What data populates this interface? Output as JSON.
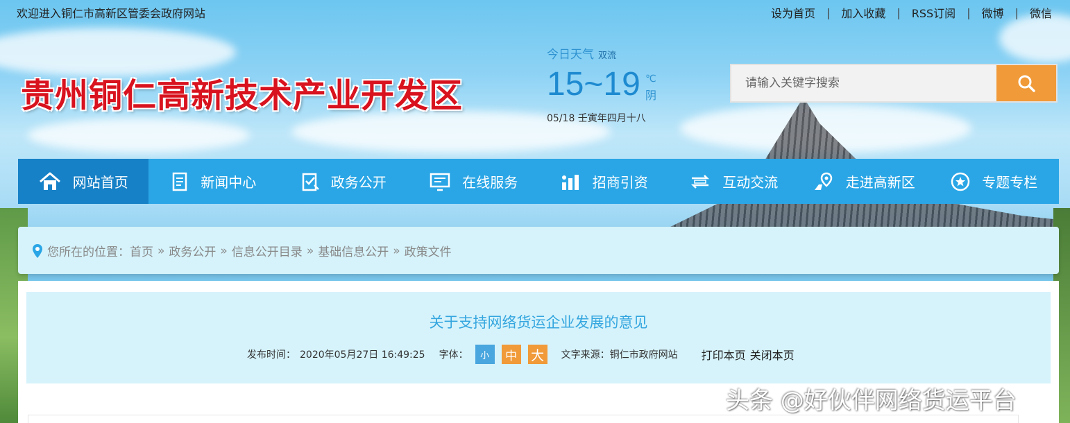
{
  "topbar": {
    "welcome": "欢迎进入铜仁市高新区管委会政府网站",
    "links": [
      "设为首页",
      "加入收藏",
      "RSS订阅",
      "微博",
      "微信"
    ],
    "separator": "|"
  },
  "header": {
    "site_title": "贵州铜仁高新技术产业开发区"
  },
  "weather": {
    "label": "今日天气",
    "city": "双流",
    "temp_range": "15~19",
    "unit": "℃",
    "condition": "阴",
    "date": "05/18 壬寅年四月十八"
  },
  "search": {
    "placeholder": "请输入关键字搜索",
    "button_icon": "search-icon"
  },
  "nav": {
    "items": [
      {
        "label": "网站首页",
        "icon": "home-icon"
      },
      {
        "label": "新闻中心",
        "icon": "document-icon"
      },
      {
        "label": "政务公开",
        "icon": "checklist-icon"
      },
      {
        "label": "在线服务",
        "icon": "monitor-icon"
      },
      {
        "label": "招商引资",
        "icon": "investment-icon"
      },
      {
        "label": "互动交流",
        "icon": "exchange-icon"
      },
      {
        "label": "走进高新区",
        "icon": "map-pin-icon"
      },
      {
        "label": "专题专栏",
        "icon": "star-icon"
      }
    ]
  },
  "breadcrumb": {
    "prefix": "您所在的位置：",
    "items": [
      "首页",
      "政务公开",
      "信息公开目录",
      "基础信息公开",
      "政策文件"
    ],
    "separator": "»"
  },
  "article": {
    "title": "关于支持网络货运企业发展的意见",
    "time_label": "发布时间：",
    "time_value": "2020年05月27日 16:49:25",
    "font_label": "字体：",
    "font_small": "小",
    "font_mid": "中",
    "font_large": "大",
    "source": "文字来源：铜仁市政府网站",
    "print": "打印本页",
    "close": "关闭本页"
  },
  "watermark": "头条 @好伙伴网络货运平台",
  "colors": {
    "nav_bg": "#2aa6e6",
    "nav_active": "#1781c7",
    "accent_orange": "#f09a39",
    "title_red": "#d8121e",
    "panel_bg": "#d6f3fb"
  }
}
